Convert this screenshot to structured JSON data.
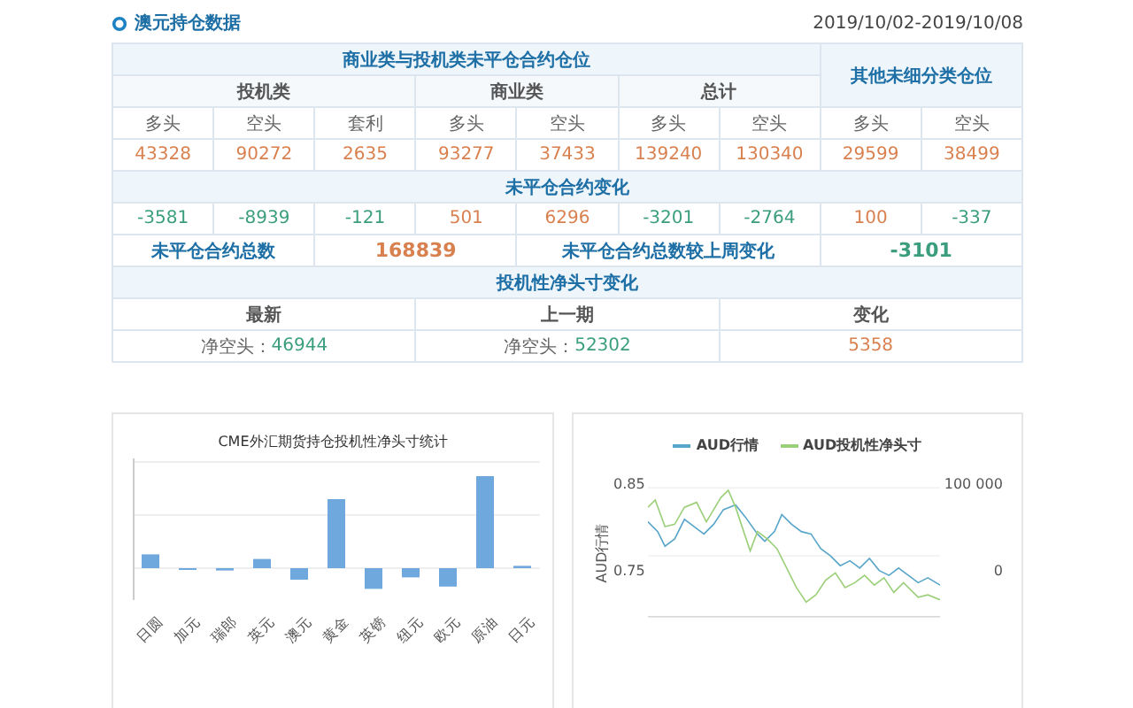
{
  "header": {
    "title": "澳元持仓数据",
    "date_range": "2019/10/02-2019/10/08"
  },
  "table": {
    "group_title": "商业类与投机类未平仓合约仓位",
    "other_title": "其他未细分类仓位",
    "groups": [
      "投机类",
      "商业类",
      "总计"
    ],
    "columns": [
      "多头",
      "空头",
      "套利",
      "多头",
      "空头",
      "多头",
      "空头",
      "多头",
      "空头"
    ],
    "positions": [
      "43328",
      "90272",
      "2635",
      "93277",
      "37433",
      "139240",
      "130340",
      "29599",
      "38499"
    ],
    "change_title": "未平仓合约变化",
    "changes": [
      {
        "value": "-3581",
        "color": "#3a9e7e"
      },
      {
        "value": "-8939",
        "color": "#3a9e7e"
      },
      {
        "value": "-121",
        "color": "#3a9e7e"
      },
      {
        "value": "501",
        "color": "#d9804f"
      },
      {
        "value": "6296",
        "color": "#d9804f"
      },
      {
        "value": "-3201",
        "color": "#3a9e7e"
      },
      {
        "value": "-2764",
        "color": "#3a9e7e"
      },
      {
        "value": "100",
        "color": "#d9804f"
      },
      {
        "value": "-337",
        "color": "#3a9e7e"
      }
    ],
    "total_label": "未平仓合约总数",
    "total_value": "168839",
    "total_change_label": "未平仓合约总数较上周变化",
    "total_change_value": "-3101",
    "net_title": "投机性净头寸变化",
    "net_columns": [
      "最新",
      "上一期",
      "变化"
    ],
    "net_values": [
      {
        "label": "净空头：",
        "value": "46944",
        "color": "#3a9e7e"
      },
      {
        "label": "净空头：",
        "value": "52302",
        "color": "#3a9e7e"
      },
      {
        "value": "5358",
        "color": "#d9804f"
      }
    ]
  },
  "bar_chart": {
    "title": "CME外汇期货持仓投机性净头寸统计",
    "categories": [
      "日圆",
      "加元",
      "瑞郎",
      "英元",
      "澳元",
      "黄金",
      "英镑",
      "纽元",
      "欧元",
      "原油",
      "日元"
    ]
  },
  "line_chart": {
    "legend": [
      "AUD行情",
      "AUD投机性净头寸"
    ],
    "ylabel": "AUD行情",
    "left_ticks": [
      "0.85",
      "0.75"
    ],
    "right_ticks": [
      "100 000",
      "0"
    ]
  }
}
